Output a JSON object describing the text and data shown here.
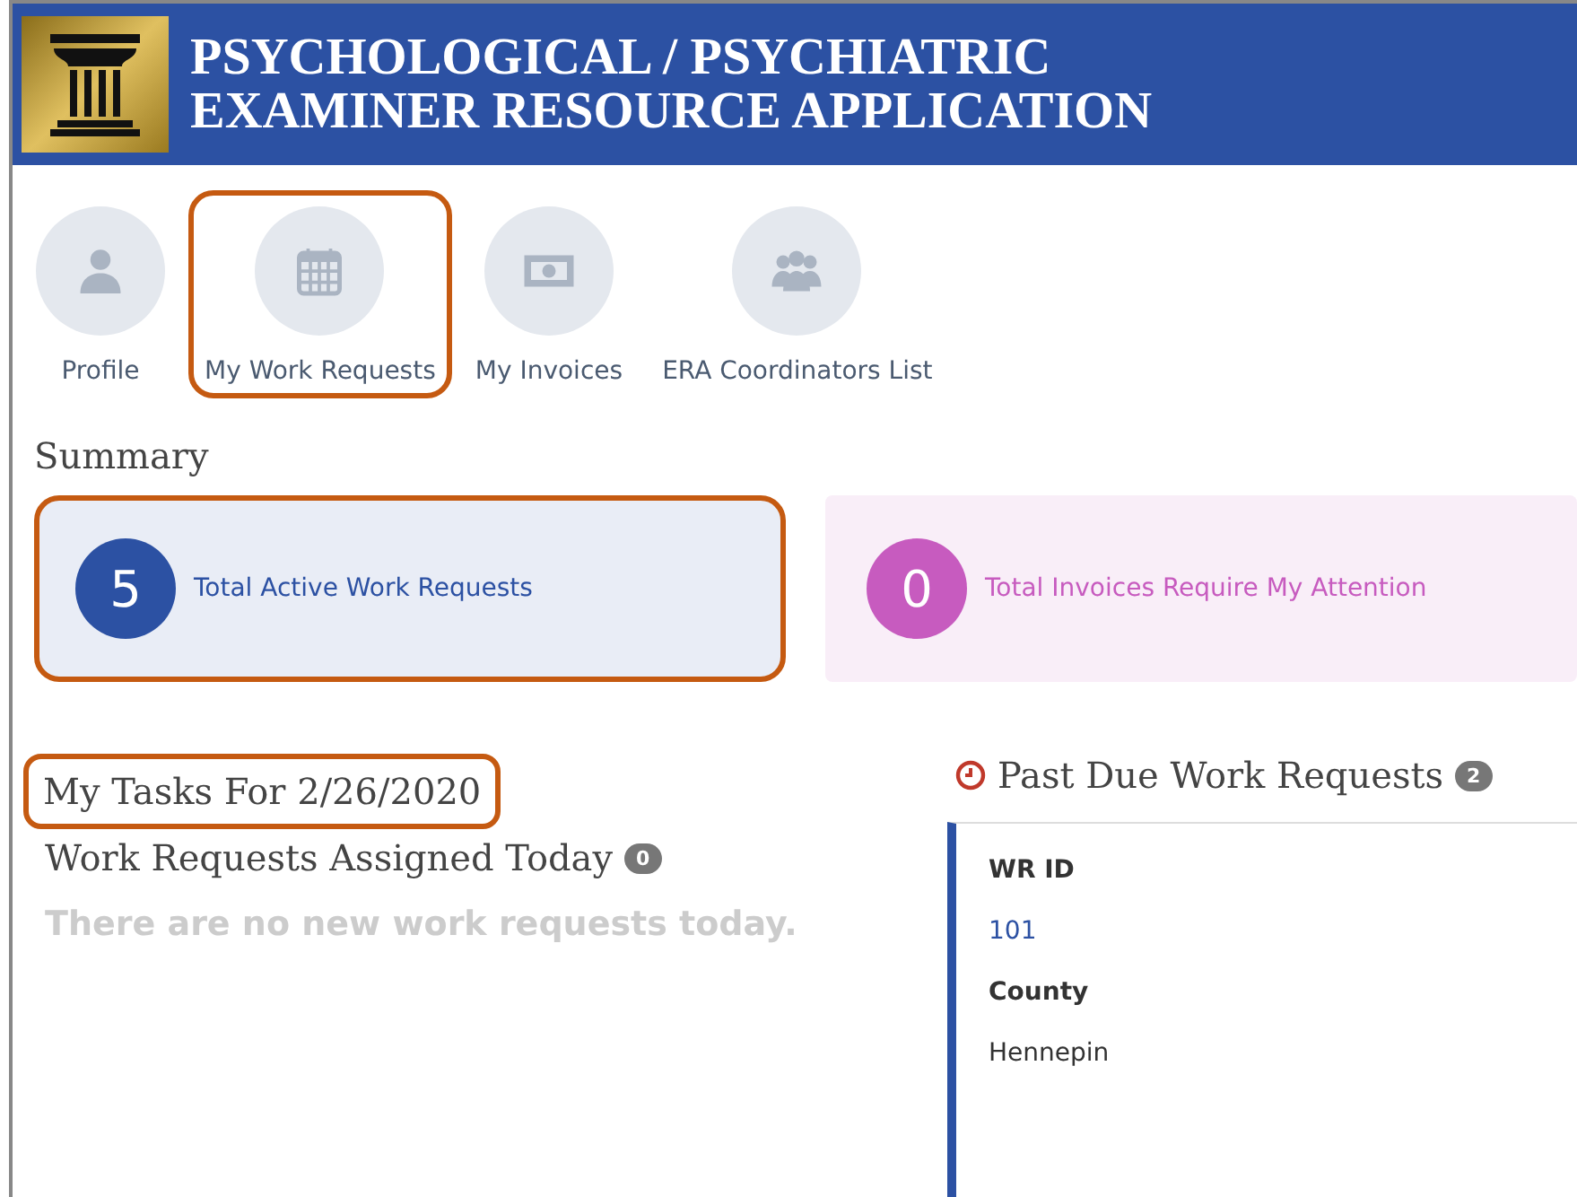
{
  "header": {
    "title_line_1": "PSYCHOLOGICAL / PSYCHIATRIC",
    "title_line_2": "EXAMINER RESOURCE APPLICATION"
  },
  "nav": [
    {
      "kind": "person",
      "label": "Profile",
      "highlighted": false
    },
    {
      "kind": "calendar",
      "label": "My Work Requests",
      "highlighted": true
    },
    {
      "kind": "money",
      "label": "My Invoices",
      "highlighted": false
    },
    {
      "kind": "group",
      "label": "ERA Coordinators List",
      "highlighted": false
    }
  ],
  "summary": {
    "title": "Summary",
    "cards": [
      {
        "count": "5",
        "label": "Total Active Work Requests",
        "color": "#2c51a3",
        "highlighted": true
      },
      {
        "count": "0",
        "label": "Total Invoices Require My Attention",
        "color": "#c75bbf",
        "highlighted": false
      }
    ]
  },
  "tasks": {
    "title": "My Tasks For 2/26/2020",
    "highlighted": true,
    "assigned_title": "Work Requests Assigned Today",
    "assigned_count": "0",
    "empty_message": "There are no new work requests today."
  },
  "past_due": {
    "title": "Past Due Work Requests",
    "count": "2",
    "fields": [
      {
        "label": "WR ID",
        "value": "101",
        "kind": "link"
      },
      {
        "label": "County",
        "value": "Hennepin",
        "kind": "text"
      }
    ]
  }
}
